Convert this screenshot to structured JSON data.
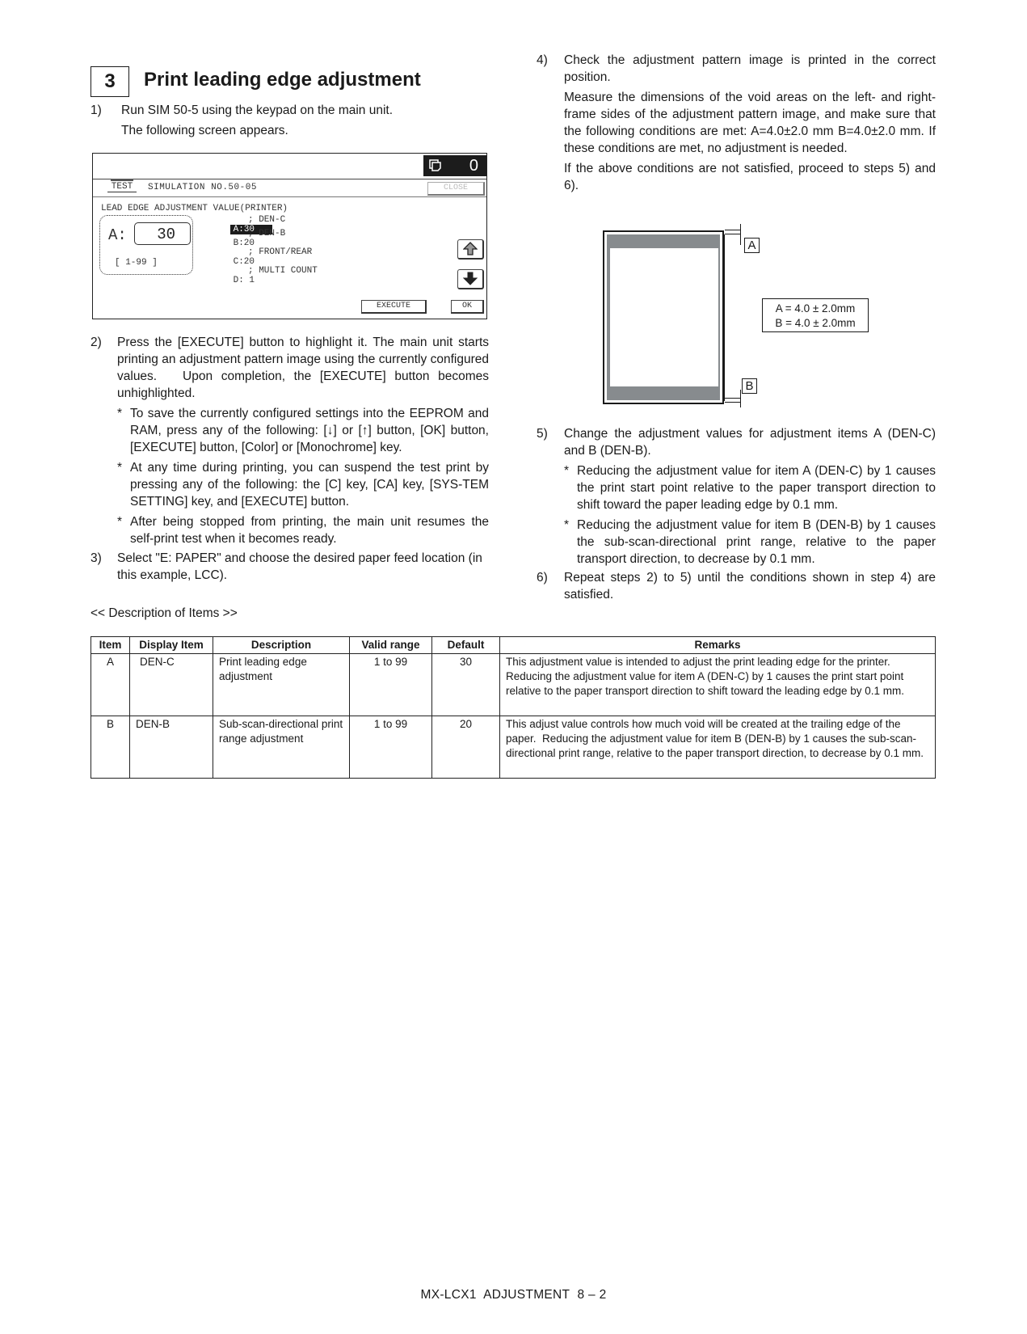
{
  "section": {
    "number": "3",
    "title": "Print leading edge adjustment"
  },
  "steps": {
    "s1": {
      "num": "1)",
      "lines": [
        "Run SIM 50-5 using the keypad on the main unit.",
        "The following screen appears."
      ]
    },
    "s2": {
      "num": "2)",
      "text": "Press the [EXECUTE] button to highlight it. The main unit starts printing an adjustment pattern image using the currently configured values.   Upon completion, the [EXECUTE] button becomes unhighlighted.",
      "notes": [
        "To save the currently configured settings into the EEPROM and RAM, press any of the following: [↓] or [↑] button, [OK] button, [EXECUTE] button, [Color] or [Monochrome] key.",
        "At any time during printing, you can suspend the test print by pressing any of the following: the [C] key, [CA] key, [SYS-TEM SETTING] key, and [EXECUTE] button.",
        "After being stopped from printing, the main unit resumes the self-print test when it becomes ready."
      ]
    },
    "s3": {
      "num": "3)",
      "text": "Select \"E: PAPER\" and choose the desired paper feed location (in this example, LCC)."
    },
    "s4": {
      "num": "4)",
      "text": "Check the adjustment pattern image is printed in the correct position.",
      "para2": "Measure the dimensions of the void areas on the left- and right-frame sides of the adjustment pattern image, and make sure that the following conditions are met: A=4.0±2.0 mm B=4.0±2.0 mm. If these conditions are met, no adjustment is needed.",
      "para3": "If the above conditions are not satisfied, proceed to steps 5) and 6)."
    },
    "s5": {
      "num": "5)",
      "text": "Change the adjustment values for adjustment items A (DEN-C) and B (DEN-B).",
      "notes": [
        "Reducing the adjustment value for item A (DEN-C) by 1 causes the print start point relative to the paper transport direction to shift toward the paper leading edge by 0.1 mm.",
        "Reducing the adjustment value for item B (DEN-B) by 1 causes the sub-scan-directional print range, relative to the paper transport direction, to decrease by 0.1 mm."
      ]
    },
    "s6": {
      "num": "6)",
      "text": "Repeat steps 2) to 5) until the conditions shown in step 4) are satisfied."
    }
  },
  "note_marker": "*",
  "screen": {
    "copy_count": "0",
    "copy_icon": "copy-pages-icon",
    "test_tag": "TEST",
    "sim_title": "SIMULATION NO.50-05",
    "close_label": "CLOSE",
    "lead_label": "LEAD EDGE ADJUSTMENT VALUE(PRINTER)",
    "current_letter": "A:",
    "current_value": "30",
    "range": "[ 1-99 ]",
    "items": [
      {
        "code": "A:30",
        "name": "; DEN-C",
        "selected": true
      },
      {
        "code": "B:20",
        "name": "; DEN-B",
        "selected": false
      },
      {
        "code": "C:20",
        "name": "; FRONT/REAR",
        "selected": false
      },
      {
        "code": "D: 1",
        "name": "; MULTI COUNT",
        "selected": false
      }
    ],
    "up_icon": "arrow-up-icon",
    "down_icon": "arrow-down-icon",
    "execute_label": "EXECUTE",
    "ok_label": "OK"
  },
  "diagram": {
    "label_a": "A",
    "label_b": "B",
    "formula_a": "A = 4.0 ± 2.0mm",
    "formula_b": "B = 4.0 ± 2.0mm"
  },
  "desc_heading": "<< Description of Items >>",
  "table": {
    "headers": [
      "Item",
      "Display Item",
      "Description",
      "Valid range",
      "Default",
      "Remarks"
    ],
    "rows": [
      {
        "item": "A",
        "display": "DEN-C",
        "description": "Print leading edge adjustment",
        "range": "1 to 99",
        "default": "30",
        "remarks": "This adjustment value is intended to adjust the print leading edge for the printer. Reducing the adjustment value for item A (DEN-C) by 1 causes the print start point relative to the paper transport direction to shift toward the leading edge by 0.1 mm."
      },
      {
        "item": "B",
        "display": "DEN-B",
        "description": "Sub-scan-directional print range adjustment",
        "range": "1 to 99",
        "default": "20",
        "remarks": "This adjust value controls how much void will be created at the trailing edge of the paper.  Reducing the adjustment value for item B (DEN-B) by 1 causes the sub-scan-directional print range, relative to the paper transport direction, to decrease by 0.1 mm."
      }
    ]
  },
  "footer": "MX-LCX1  ADJUSTMENT  8 – 2"
}
